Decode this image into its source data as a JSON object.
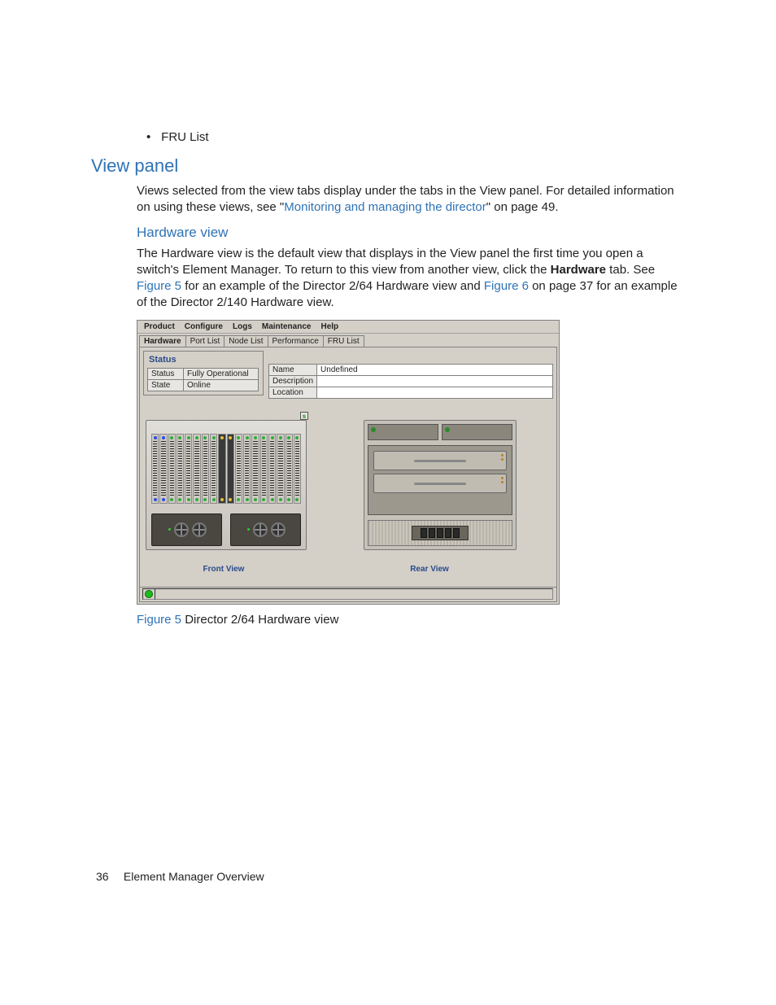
{
  "bullet": "FRU List",
  "h2": "View panel",
  "p1_a": "Views selected from the view tabs display under the tabs in the View panel. For detailed information on using these views, see \"",
  "p1_link": "Monitoring and managing the director",
  "p1_b": "\" on page 49.",
  "h3": "Hardware view",
  "p2_a": "The Hardware view is the default view that displays in the View panel the first time you open a switch's Element Manager. To return to this view from another view, click the ",
  "p2_bold": "Hardware",
  "p2_b": " tab. See ",
  "p2_link1": "Figure 5",
  "p2_c": " for an example of the Director 2/64 Hardware view and ",
  "p2_link2": "Figure 6",
  "p2_d": " on page 37 for an example of the Director 2/140 Hardware view.",
  "app": {
    "menus": [
      "Product",
      "Configure",
      "Logs",
      "Maintenance",
      "Help"
    ],
    "tabs": [
      "Hardware",
      "Port List",
      "Node List",
      "Performance",
      "FRU List"
    ],
    "status_title": "Status",
    "left_kv": [
      {
        "k": "Status",
        "v": "Fully Operational"
      },
      {
        "k": "State",
        "v": "Online"
      }
    ],
    "right_kv": [
      {
        "k": "Name",
        "v": "Undefined"
      },
      {
        "k": "Description",
        "v": ""
      },
      {
        "k": "Location",
        "v": ""
      }
    ],
    "front_label": "Front View",
    "rear_label": "Rear View"
  },
  "caption_fig": "Figure 5",
  "caption_text": " Director 2/64 Hardware view",
  "footer_page": "36",
  "footer_text": "Element Manager Overview"
}
